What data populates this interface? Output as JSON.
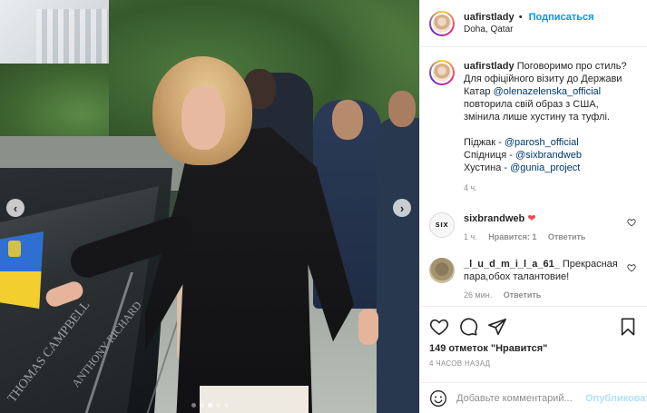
{
  "header": {
    "username": "uafirstlady",
    "separator": "•",
    "follow_label": "Подписаться",
    "location": "Doha, Qatar"
  },
  "caption": {
    "username": "uafirstlady",
    "line1": "Поговоримо про стиль?",
    "line2": "Для офіційного візиту до Держави",
    "line3_text": "Катар ",
    "line3_mention": "@olenazelenska_official",
    "line4": "повторила свій образ з США,",
    "line5": "змінила лише хустину та туфлі.",
    "item1_label": "Піджак - ",
    "item1_mention": "@parosh_official",
    "item2_label": "Спідниця - ",
    "item2_mention": "@sixbrandweb",
    "item3_label": "Хустина - ",
    "item3_mention": "@gunia_project",
    "time": "4 ч."
  },
  "comments": [
    {
      "avatar_text": "SIX",
      "username": "sixbrandweb",
      "text": "❤",
      "time": "1 ч.",
      "likes": "Нравится: 1",
      "reply": "Ответить"
    },
    {
      "username": "_l_u_d_m_i_l_a_61_",
      "text": "Прекрасная пара,обох талантовие!",
      "time": "26 мин.",
      "reply": "Ответить"
    }
  ],
  "actions": {
    "likes_text": "149 отметок \"Нравится\"",
    "posted_ago": "4 ЧАСОВ НАЗАД"
  },
  "add_comment": {
    "placeholder": "Добавьте комментарий...",
    "post_label": "Опубликовать"
  },
  "carousel": {
    "prev_label": "‹",
    "next_label": "›",
    "slide_count": 5,
    "active_slide": 2
  },
  "photo_text": {
    "engraving1": "THOMAS CAMPBELL",
    "engraving2": "ANTHONY RICHARD"
  },
  "colors": {
    "accent": "#0095f6",
    "mention": "#00376b",
    "like_red": "#ed4956",
    "muted": "#8e8e8e"
  }
}
